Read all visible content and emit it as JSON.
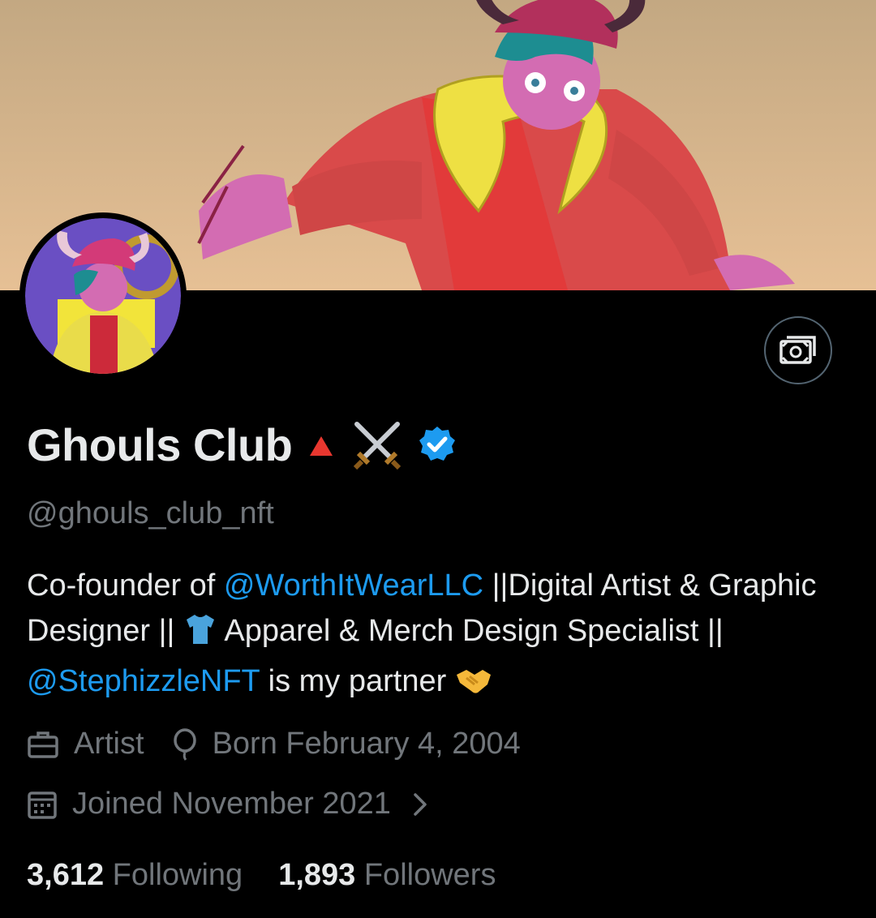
{
  "profile": {
    "display_name": "Ghouls Club",
    "handle": "@ghouls_club_nft",
    "verified": true
  },
  "bio": {
    "part1": "Co-founder of ",
    "mention1": "@WorthItWearLLC",
    "part2": " ||Digital Artist & Graphic Designer || ",
    "part3": " Apparel & Merch Design Specialist || ",
    "mention2": "@StephizzleNFT",
    "part4": " is my partner "
  },
  "meta": {
    "profession": "Artist",
    "birthday": "Born February 4, 2004",
    "joined": "Joined November 2021"
  },
  "stats": {
    "following_count": "3,612",
    "following_label": "Following",
    "followers_count": "1,893",
    "followers_label": "Followers"
  },
  "colors": {
    "background": "#000000",
    "text_primary": "#e7e9ea",
    "text_secondary": "#71767b",
    "accent": "#1d9bf0"
  },
  "icons": [
    "tip-money-icon",
    "red-triangle-icon",
    "crossed-swords-icon",
    "verified-badge-icon",
    "briefcase-icon",
    "balloon-icon",
    "calendar-icon",
    "chevron-right-icon",
    "tshirt-icon",
    "handshake-icon"
  ]
}
